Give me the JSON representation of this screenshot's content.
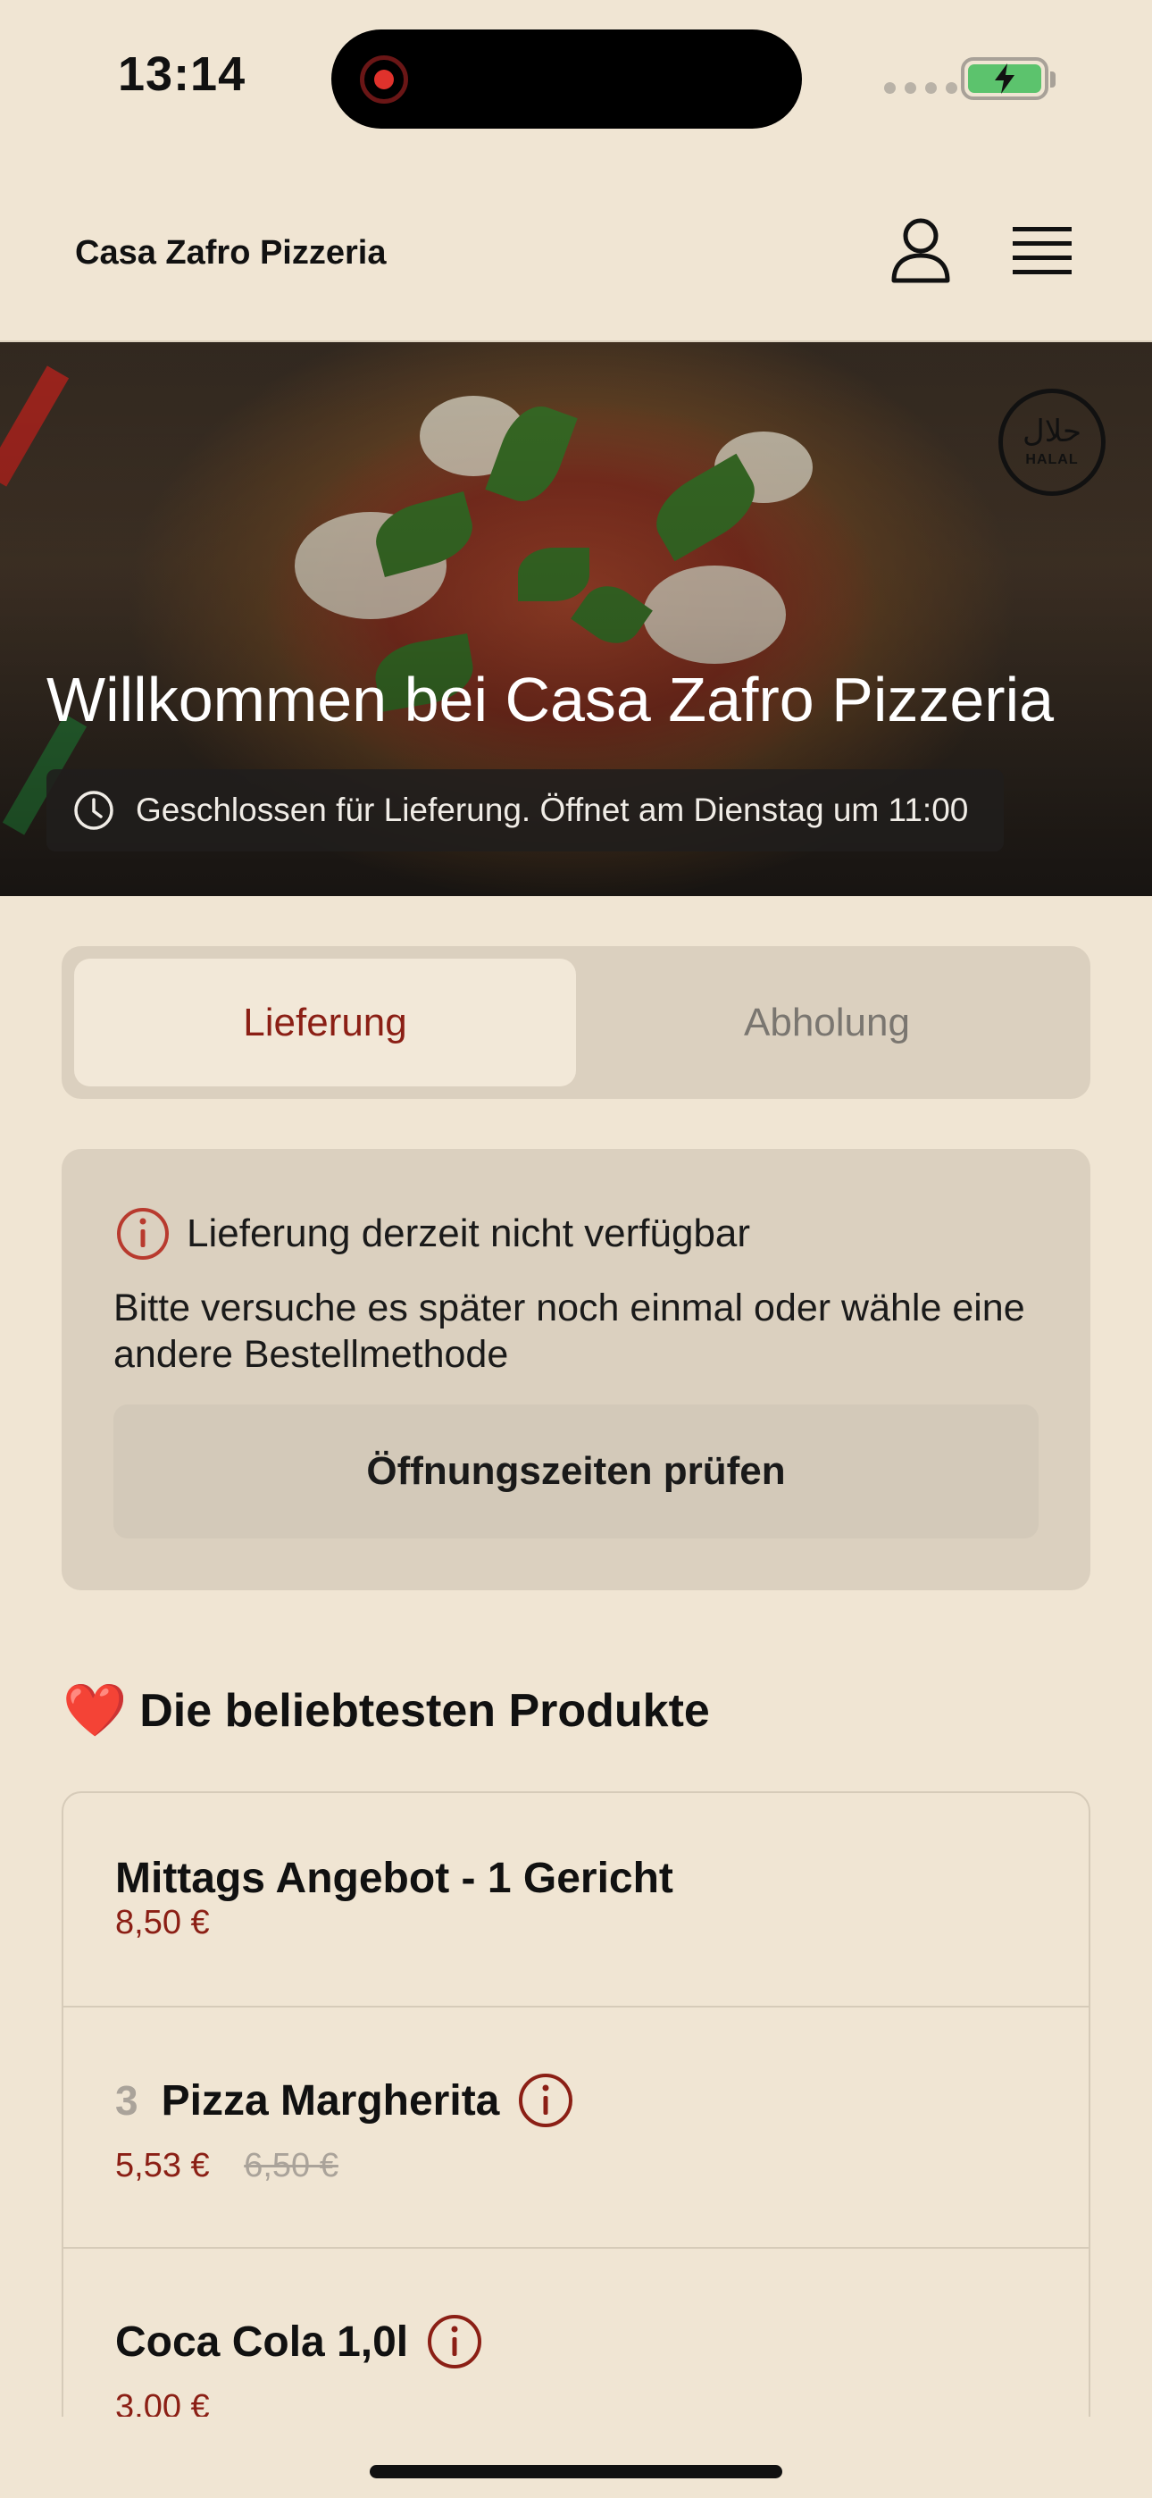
{
  "status_bar": {
    "time": "13:14",
    "battery_color": "#5cc36d"
  },
  "header": {
    "title": "Casa Zafro Pizzeria",
    "user_icon": "user-icon",
    "menu_icon": "hamburger-menu-icon"
  },
  "hero": {
    "badge_arabic": "حلال",
    "badge_text": "HALAL",
    "title": "Willkommen bei Casa Zafro Pizzeria",
    "status": "Geschlossen für Lieferung. Öffnet am Dienstag um 11:00",
    "status_icon": "clock-icon"
  },
  "order_mode": {
    "options": [
      "Lieferung",
      "Abholung"
    ],
    "selected": "Lieferung",
    "accent_color": "#8b1f15"
  },
  "notice": {
    "icon": "info-icon",
    "title": "Lieferung derzeit nicht verfügbar",
    "text": "Bitte versuche es später noch einmal oder wähle eine andere Bestellmethode",
    "button": "Öffnungszeiten prüfen"
  },
  "popular": {
    "title": "Die beliebtesten Produkte",
    "icon": "heart-icon",
    "heart_glyph": "❤️",
    "products": [
      {
        "name": "Mittags Angebot - 1 Gericht",
        "price": "8,50 €"
      },
      {
        "quantity": "3",
        "name": "Pizza Margherita",
        "price": "5,53 €",
        "old_price": "6,50 €",
        "has_info": true
      },
      {
        "name": "Coca Cola 1,0l",
        "price": "3,00 €",
        "has_info": true
      }
    ]
  }
}
